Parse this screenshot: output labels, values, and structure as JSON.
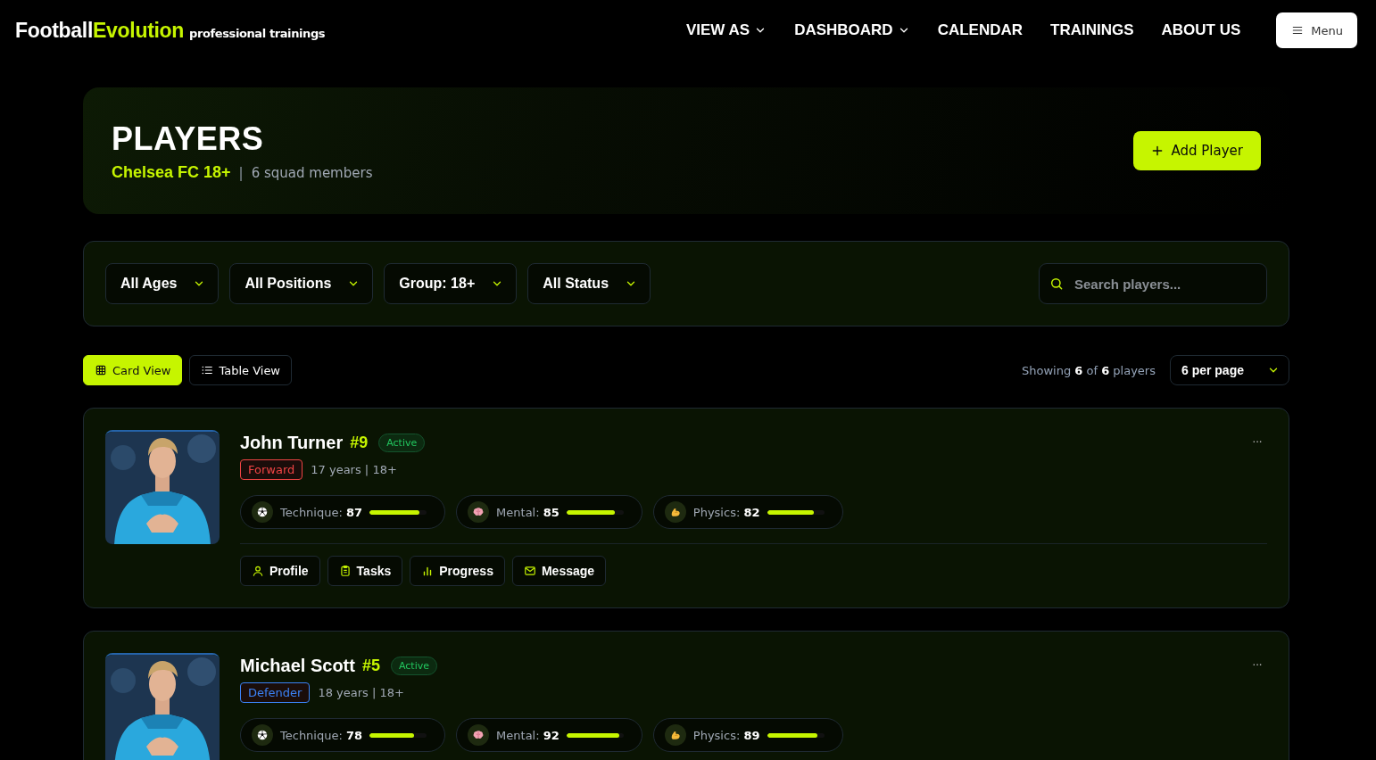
{
  "brand": {
    "name": "Football",
    "accent": "Evolution",
    "tagline": "professional trainings"
  },
  "nav": [
    {
      "label": "VIEW AS",
      "dropdown": true
    },
    {
      "label": "DASHBOARD",
      "dropdown": true
    },
    {
      "label": "CALENDAR",
      "dropdown": false
    },
    {
      "label": "TRAININGS",
      "dropdown": false
    },
    {
      "label": "ABOUT US",
      "dropdown": false
    }
  ],
  "menu_button": "Menu",
  "hero": {
    "title": "PLAYERS",
    "team": "Chelsea FC 18+",
    "separator": "|",
    "members": "6 squad members",
    "add_button": "Add Player"
  },
  "filters": [
    "All Ages",
    "All Positions",
    "Group: 18+",
    "All Status"
  ],
  "search": {
    "placeholder": "Search players..."
  },
  "views": [
    {
      "label": "Card View",
      "kind": "grid",
      "selected": true
    },
    {
      "label": "Table View",
      "kind": "list",
      "selected": false
    }
  ],
  "showing": "Showing **6** of **6** players",
  "per_page": "6 per page",
  "players": [
    {
      "name": "John Turner",
      "number": "#9",
      "status": "Active",
      "position": "Forward",
      "color": "#ef4444",
      "meta": "17 years | 18+",
      "more": "···",
      "stats": [
        {
          "kind": "technique",
          "label": "Technique:",
          "value": "87",
          "level": 0.87
        },
        {
          "kind": "mental",
          "label": "Mental:",
          "value": "85",
          "level": 0.85
        },
        {
          "kind": "physics",
          "label": "Physics:",
          "value": "82",
          "level": 0.82
        }
      ],
      "actions": [
        {
          "kind": "profile",
          "label": "Profile"
        },
        {
          "kind": "tasks",
          "label": "Tasks"
        },
        {
          "kind": "progress",
          "label": "Progress"
        },
        {
          "kind": "message",
          "label": "Message"
        }
      ]
    },
    {
      "name": "Michael Scott",
      "number": "#5",
      "status": "Active",
      "position": "Defender",
      "color": "#3b82f6",
      "meta": "18 years | 18+",
      "more": "···",
      "stats": [
        {
          "kind": "technique",
          "label": "Technique:",
          "value": "78",
          "level": 0.78
        },
        {
          "kind": "mental",
          "label": "Mental:",
          "value": "92",
          "level": 0.92
        },
        {
          "kind": "physics",
          "label": "Physics:",
          "value": "89",
          "level": 0.89
        }
      ]
    }
  ]
}
